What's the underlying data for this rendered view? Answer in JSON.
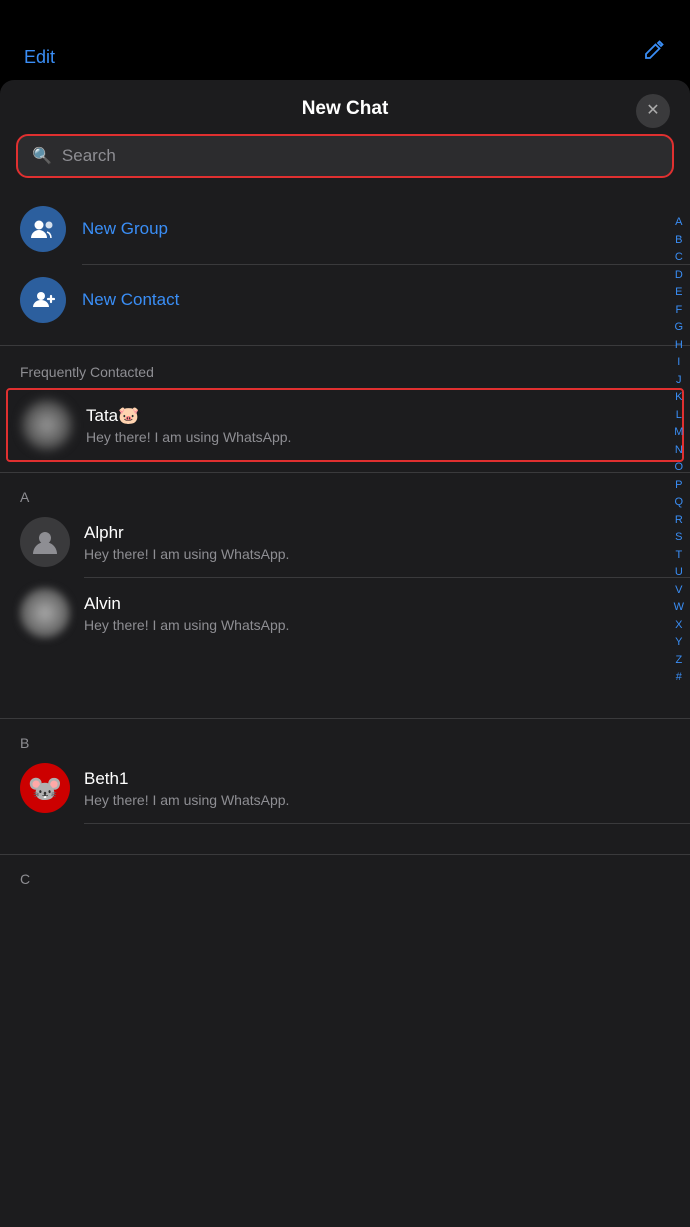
{
  "topBar": {
    "editLabel": "Edit",
    "composeIcon": "✏️"
  },
  "header": {
    "title": "New Chat",
    "closeIcon": "✕"
  },
  "search": {
    "placeholder": "Search"
  },
  "actions": [
    {
      "id": "new-group",
      "icon": "👥",
      "label": "New Group"
    },
    {
      "id": "new-contact",
      "icon": "👤+",
      "label": "New Contact"
    }
  ],
  "frequentlyContacted": {
    "sectionLabel": "Frequently Contacted",
    "contacts": [
      {
        "id": "tata",
        "name": "Tata🐷",
        "status": "Hey there! I am using WhatsApp.",
        "avatarType": "blur"
      }
    ]
  },
  "contactGroups": [
    {
      "letter": "A",
      "contacts": [
        {
          "id": "alphr",
          "name": "Alphr",
          "status": "Hey there! I am using WhatsApp.",
          "avatarType": "placeholder"
        },
        {
          "id": "alvin",
          "name": "Alvin",
          "status": "Hey there! I am using WhatsApp.",
          "avatarType": "blur"
        }
      ]
    },
    {
      "letter": "B",
      "contacts": [
        {
          "id": "beth1",
          "name": "Beth1",
          "status": "Hey there! I am using WhatsApp.",
          "avatarType": "minnie"
        }
      ]
    },
    {
      "letter": "C",
      "contacts": []
    }
  ],
  "alphaIndex": [
    "A",
    "B",
    "C",
    "D",
    "E",
    "F",
    "G",
    "H",
    "I",
    "J",
    "K",
    "L",
    "M",
    "N",
    "O",
    "P",
    "Q",
    "R",
    "S",
    "T",
    "U",
    "V",
    "W",
    "X",
    "Y",
    "Z",
    "#"
  ]
}
